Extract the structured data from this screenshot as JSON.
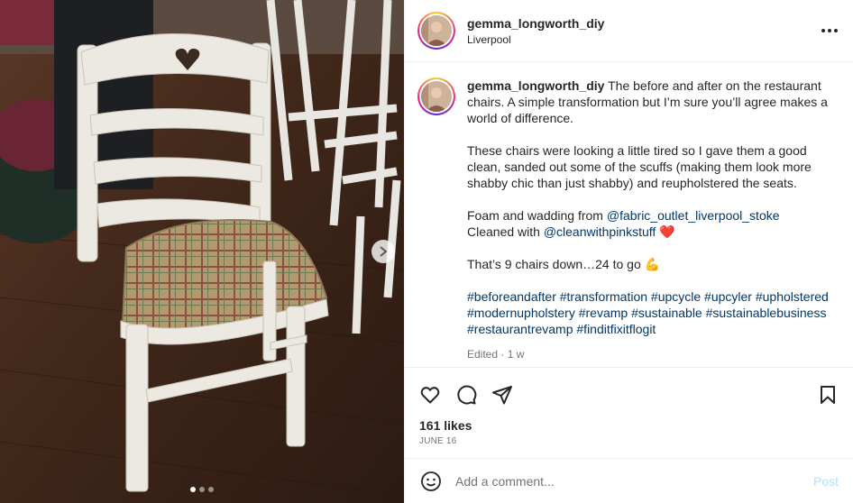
{
  "post": {
    "username": "gemma_longworth_diy",
    "location": "Liverpool",
    "caption": {
      "p1": "The before and after on the restaurant chairs. A simple transformation but I’m sure you’ll agree makes a world of difference.",
      "p2": "These chairs were looking a little tired so I gave them a good clean, sanded out some of the scuffs (making them look more shabby chic than just shabby) and reupholstered the seats.",
      "p3_prefix": "Foam and wadding from ",
      "p3_link1": "@fabric_outlet_liverpool_stoke",
      "p3_mid": "Cleaned with ",
      "p3_link2": "@cleanwithpinkstuff",
      "p3_emoji": "❤️",
      "p4_text": "That’s 9 chairs down…24 to go ",
      "p4_emoji": "💪",
      "hashtags": "#beforeandafter #transformation #upcycle #upcyler #upholstered #modernupholstery #revamp #sustainable #sustainablebusiness #restaurantrevamp #finditfixitflogit"
    },
    "edited_meta": "Edited · 1 w",
    "likes": "161 likes",
    "date": "JUNE 16"
  },
  "comment_box": {
    "placeholder": "Add a comment...",
    "post_label": "Post"
  },
  "carousel": {
    "count": 3,
    "active_index": 0
  },
  "icons": {
    "more": "more-horizontal-icon",
    "like": "heart-icon",
    "comment": "comment-bubble-icon",
    "share": "paper-plane-icon",
    "save": "bookmark-icon",
    "emoji": "smiley-icon",
    "next": "chevron-right-icon"
  },
  "colors": {
    "link": "#00376b",
    "muted": "#737373",
    "post_disabled": "#b2dffc",
    "heart_emoji": "#e0245e"
  }
}
